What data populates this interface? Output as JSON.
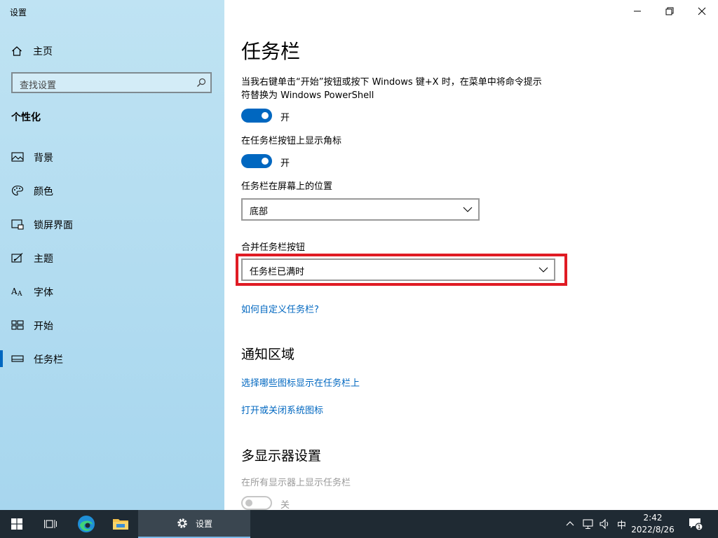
{
  "window": {
    "title": "设置"
  },
  "sidebar": {
    "home_label": "主页",
    "search_placeholder": "查找设置",
    "section_title": "个性化",
    "items": [
      {
        "label": "背景",
        "icon": "picture-icon"
      },
      {
        "label": "颜色",
        "icon": "palette-icon"
      },
      {
        "label": "锁屏界面",
        "icon": "lock-screen-icon"
      },
      {
        "label": "主题",
        "icon": "theme-brush-icon"
      },
      {
        "label": "字体",
        "icon": "font-icon"
      },
      {
        "label": "开始",
        "icon": "start-tiles-icon"
      },
      {
        "label": "任务栏",
        "icon": "taskbar-icon",
        "selected": true
      }
    ]
  },
  "main": {
    "title": "任务栏",
    "powershell": {
      "text": "当我右键单击“开始”按钮或按下 Windows 键+X 时，在菜单中将命令提示符替换为 Windows PowerShell",
      "state": "开"
    },
    "badges": {
      "text": "在任务栏按钮上显示角标",
      "state": "开"
    },
    "position": {
      "label": "任务栏在屏幕上的位置",
      "value": "底部"
    },
    "combine": {
      "label": "合并任务栏按钮",
      "value": "任务栏已满时"
    },
    "customize_link": "如何自定义任务栏?",
    "notification_area": {
      "title": "通知区域",
      "link1": "选择哪些图标显示在任务栏上",
      "link2": "打开或关闭系统图标"
    },
    "multi_display": {
      "title": "多显示器设置",
      "show_all_label": "在所有显示器上显示任务栏",
      "state": "关"
    }
  },
  "taskbar": {
    "settings_app_label": "设置",
    "ime": "中",
    "time": "2:42",
    "date": "2022/8/26",
    "notification_count": "1"
  },
  "colors": {
    "accent": "#0067c0",
    "highlight": "#e01b24",
    "taskbar": "#1f2a33"
  }
}
